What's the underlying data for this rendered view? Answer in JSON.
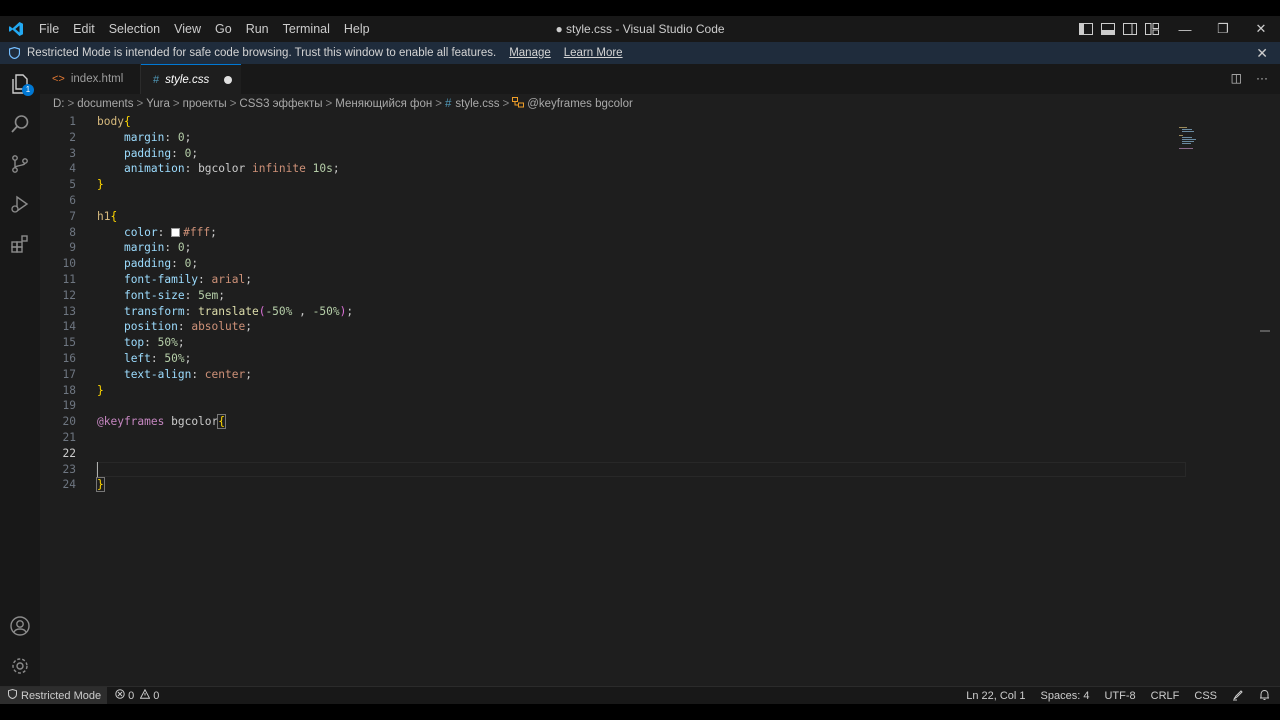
{
  "window": {
    "title": "● style.css - Visual Studio Code",
    "menu": [
      "File",
      "Edit",
      "Selection",
      "View",
      "Go",
      "Run",
      "Terminal",
      "Help"
    ],
    "controls": {
      "minimize": "—",
      "restore": "❐",
      "close": "✕"
    }
  },
  "banner": {
    "message": "Restricted Mode is intended for safe code browsing. Trust this window to enable all features.",
    "manage": "Manage",
    "learn_more": "Learn More",
    "close": "✕"
  },
  "tabs": [
    {
      "label": "index.html",
      "icon": "html-file-icon",
      "active": false
    },
    {
      "label": "style.css",
      "icon": "css-file-icon",
      "active": true,
      "modified": true
    }
  ],
  "tab_icons": {
    "html": "<>",
    "css": "#"
  },
  "tab_actions": {
    "split": "◫",
    "more": "···"
  },
  "breadcrumb": {
    "parts": [
      "D:",
      "documents",
      "Yura",
      "проекты",
      "CSS3 эффекты",
      "Меняющийся фон"
    ],
    "file": "style.css",
    "symbol": "@keyframes bgcolor",
    "separator": ">"
  },
  "editor": {
    "line_numbers": [
      "1",
      "2",
      "3",
      "4",
      "5",
      "6",
      "7",
      "8",
      "9",
      "10",
      "11",
      "12",
      "13",
      "14",
      "15",
      "16",
      "17",
      "18",
      "19",
      "20",
      "21",
      "22",
      "23",
      "24"
    ],
    "active_line": 22,
    "code": {
      "l1_sel": "body",
      "l1_brace": "{",
      "l2_prop": "margin",
      "l2_val": "0",
      "l3_prop": "padding",
      "l3_val": "0",
      "l4_prop": "animation",
      "l4_name": "bgcolor",
      "l4_kw": "infinite",
      "l4_time": "10s",
      "l5_brace": "}",
      "l7_sel": "h1",
      "l7_brace": "{",
      "l8_prop": "color",
      "l8_val": "#fff",
      "l9_prop": "margin",
      "l9_val": "0",
      "l10_prop": "padding",
      "l10_val": "0",
      "l11_prop": "font-family",
      "l11_val": "arial",
      "l12_prop": "font-size",
      "l12_val": "5em",
      "l13_prop": "transform",
      "l13_fn": "translate",
      "l13_a": "-50%",
      "l13_b": "-50%",
      "l14_prop": "position",
      "l14_val": "absolute",
      "l15_prop": "top",
      "l15_val": "50%",
      "l16_prop": "left",
      "l16_val": "50%",
      "l17_prop": "text-align",
      "l17_val": "center",
      "l18_brace": "}",
      "l20_at": "@keyframes",
      "l20_name": "bgcolor",
      "l20_brace": "{",
      "l24_brace": "}"
    }
  },
  "statusbar": {
    "restricted": "Restricted Mode",
    "errors": "0",
    "warnings": "0",
    "position": "Ln 22, Col 1",
    "spaces": "Spaces: 4",
    "encoding": "UTF-8",
    "eol": "CRLF",
    "language": "CSS"
  },
  "colors": {
    "editor_bg": "#1e1e1e",
    "chrome_bg": "#181818",
    "accent": "#0078d4",
    "banner_bg": "#1f2c3c"
  }
}
